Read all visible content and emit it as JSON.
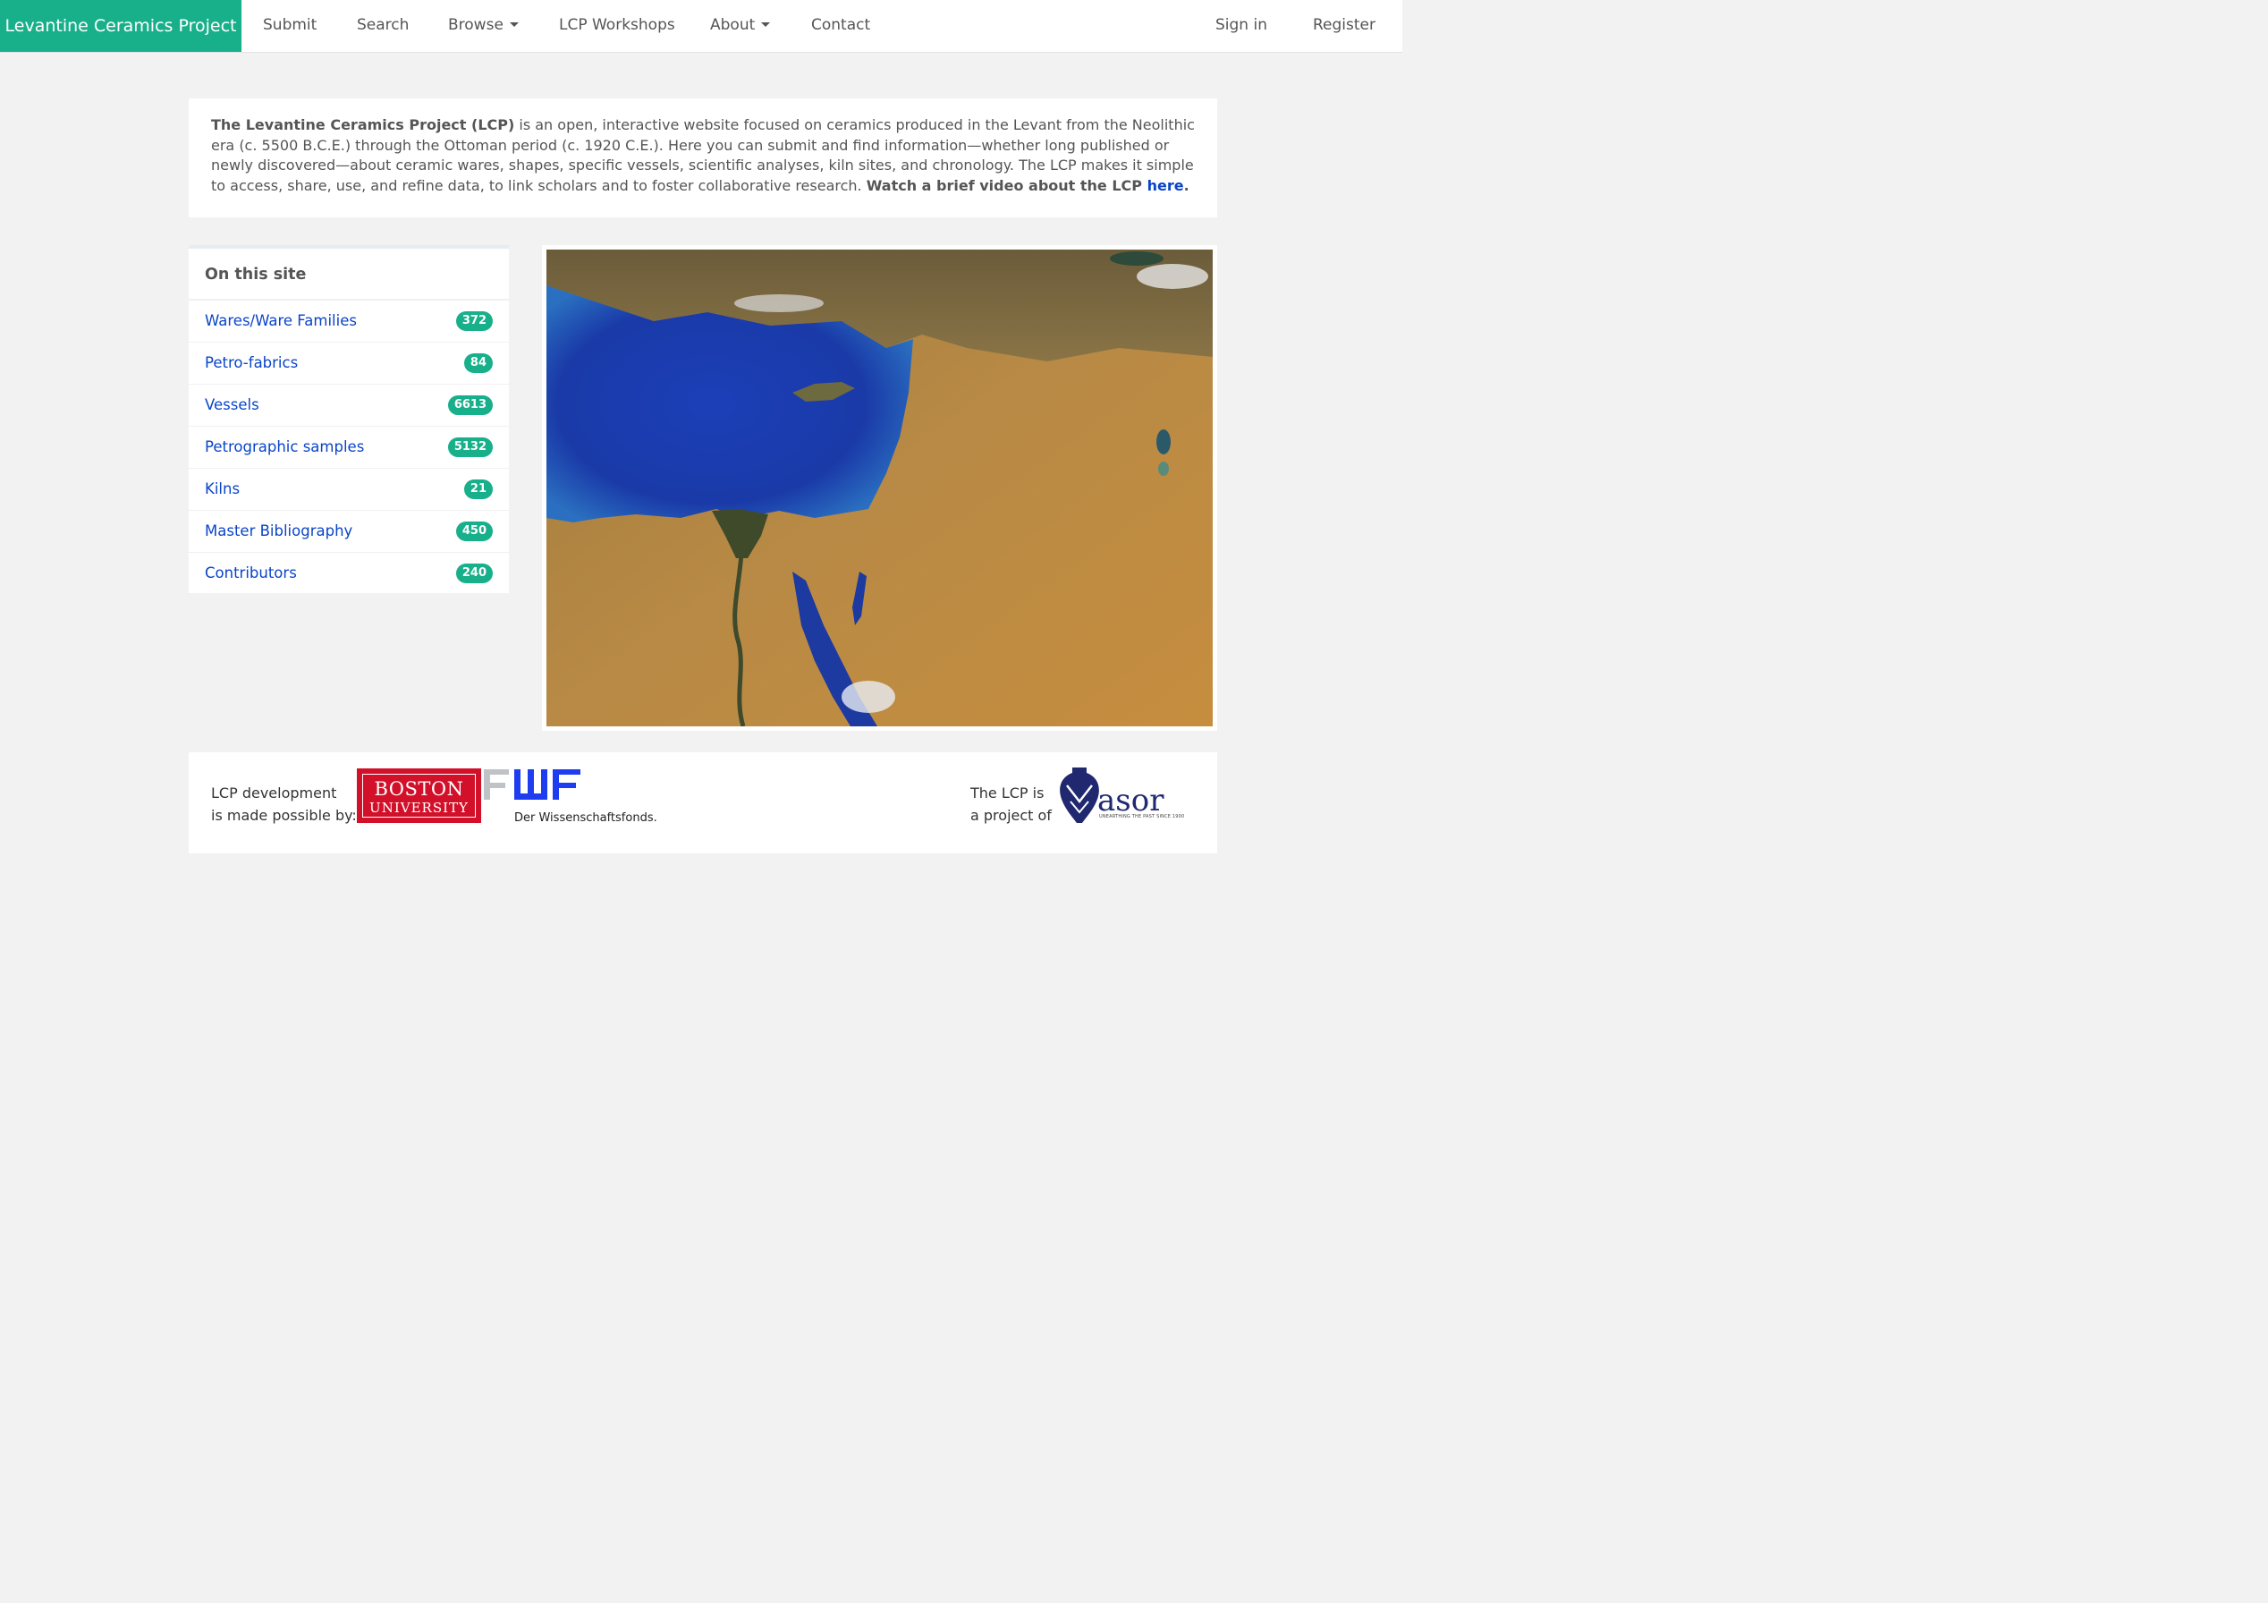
{
  "nav": {
    "brand": "Levantine Ceramics Project",
    "items": [
      {
        "label": "Submit"
      },
      {
        "label": "Search"
      },
      {
        "label": "Browse"
      },
      {
        "label": "LCP Workshops"
      },
      {
        "label": "About"
      },
      {
        "label": "Contact"
      }
    ],
    "sign_in": "Sign in",
    "register": "Register"
  },
  "intro": {
    "bold_lead": "The Levantine Ceramics Project (LCP)",
    "body": " is an open, interactive website focused on ceramics produced in the Levant from the Neolithic era (c. 5500 B.C.E.) through the Ottoman period (c. 1920 C.E.). Here you can submit and find information—whether long published or newly discovered—about ceramic wares, shapes, specific vessels, scientific analyses, kiln sites, and chronology. The LCP makes it simple to access, share, use, and refine data, to link scholars and to foster collaborative research. ",
    "video_text": "Watch a brief video about the LCP ",
    "video_link": "here",
    "video_end": "."
  },
  "sidebar": {
    "title": "On this site",
    "items": [
      {
        "label": "Wares/Ware Families",
        "count": "372"
      },
      {
        "label": "Petro-fabrics",
        "count": "84"
      },
      {
        "label": "Vessels",
        "count": "6613"
      },
      {
        "label": "Petrographic samples",
        "count": "5132"
      },
      {
        "label": "Kilns",
        "count": "21"
      },
      {
        "label": "Master Bibliography",
        "count": "450"
      },
      {
        "label": "Contributors",
        "count": "240"
      }
    ]
  },
  "footer": {
    "dev_line1": "LCP development",
    "dev_line2": "is made possible by:",
    "bu_line1": "BOSTON",
    "bu_line2": "UNIVERSITY",
    "fwf_logo": "FWF",
    "fwf_sub": "Der Wissenschaftsfonds.",
    "project_line1": "The LCP is",
    "project_line2": "a project of",
    "asor_logo": "asor",
    "asor_tagline": "UNEARTHING THE PAST SINCE 1900"
  },
  "colors": {
    "brand": "#18b08a",
    "link": "#0a44c8",
    "badge": "#18b08a",
    "bu_red": "#d3102a",
    "fwf_blue": "#1f3df0",
    "asor_navy": "#202870"
  }
}
